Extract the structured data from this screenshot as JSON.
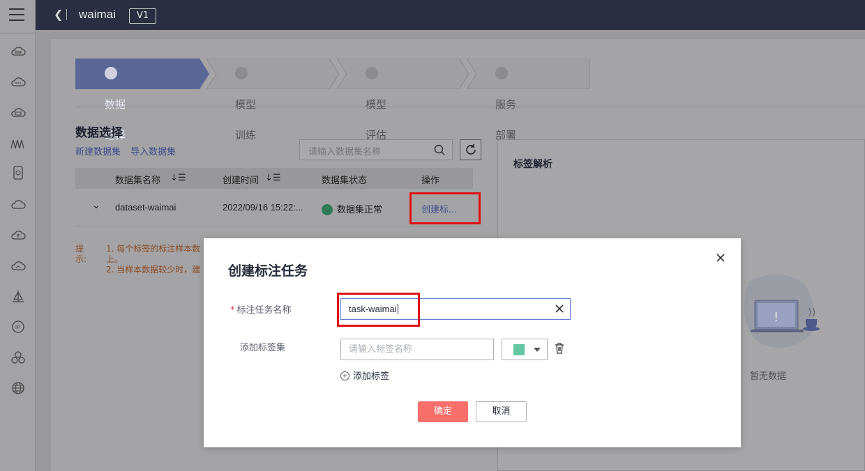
{
  "topbar": {
    "back_icon": "chevron-left-icon",
    "title": "waimai",
    "version": "V1"
  },
  "sidebar": {
    "icons": [
      "cloud-icon",
      "cloud-icon",
      "cloud-icon",
      "wave-icon",
      "database-icon",
      "cloud-icon",
      "cloud-upload-icon",
      "cloud-icon",
      "sailboat-icon",
      "ip-icon",
      "cluster-icon",
      "globe-icon"
    ]
  },
  "steps": [
    {
      "label": "数据选择",
      "active": true
    },
    {
      "label": "模型训练",
      "active": false
    },
    {
      "label": "模型评估",
      "active": false
    },
    {
      "label": "服务部署",
      "active": false
    }
  ],
  "data_section": {
    "title": "数据选择",
    "new_dataset": "新建数据集",
    "import_dataset": "导入数据集",
    "search_placeholder": "请输入数据集名称",
    "columns": [
      "数据集名称",
      "创建时间",
      "数据集状态",
      "操作"
    ],
    "row": {
      "name": "dataset-waimai",
      "created": "2022/09/16 15:22:...",
      "status": "数据集正常",
      "action": "创建标..."
    },
    "hint_label_1": "提",
    "hint_label_2": "示:",
    "hint_1": "1. 每个标签的标注样本数",
    "hint_1b": "上。",
    "hint_2": "2. 当样本数据较少时，建"
  },
  "right_panel": {
    "title": "标签解析",
    "empty": "暂无数据"
  },
  "modal": {
    "title": "创建标注任务",
    "name_label": "标注任务名称",
    "name_value": "task-waimai",
    "tagset_label": "添加标签集",
    "tag_placeholder": "请输入标签名称",
    "tag_color": "#63c7a4",
    "add_tag": "添加标签",
    "ok": "确定",
    "cancel": "取消"
  }
}
